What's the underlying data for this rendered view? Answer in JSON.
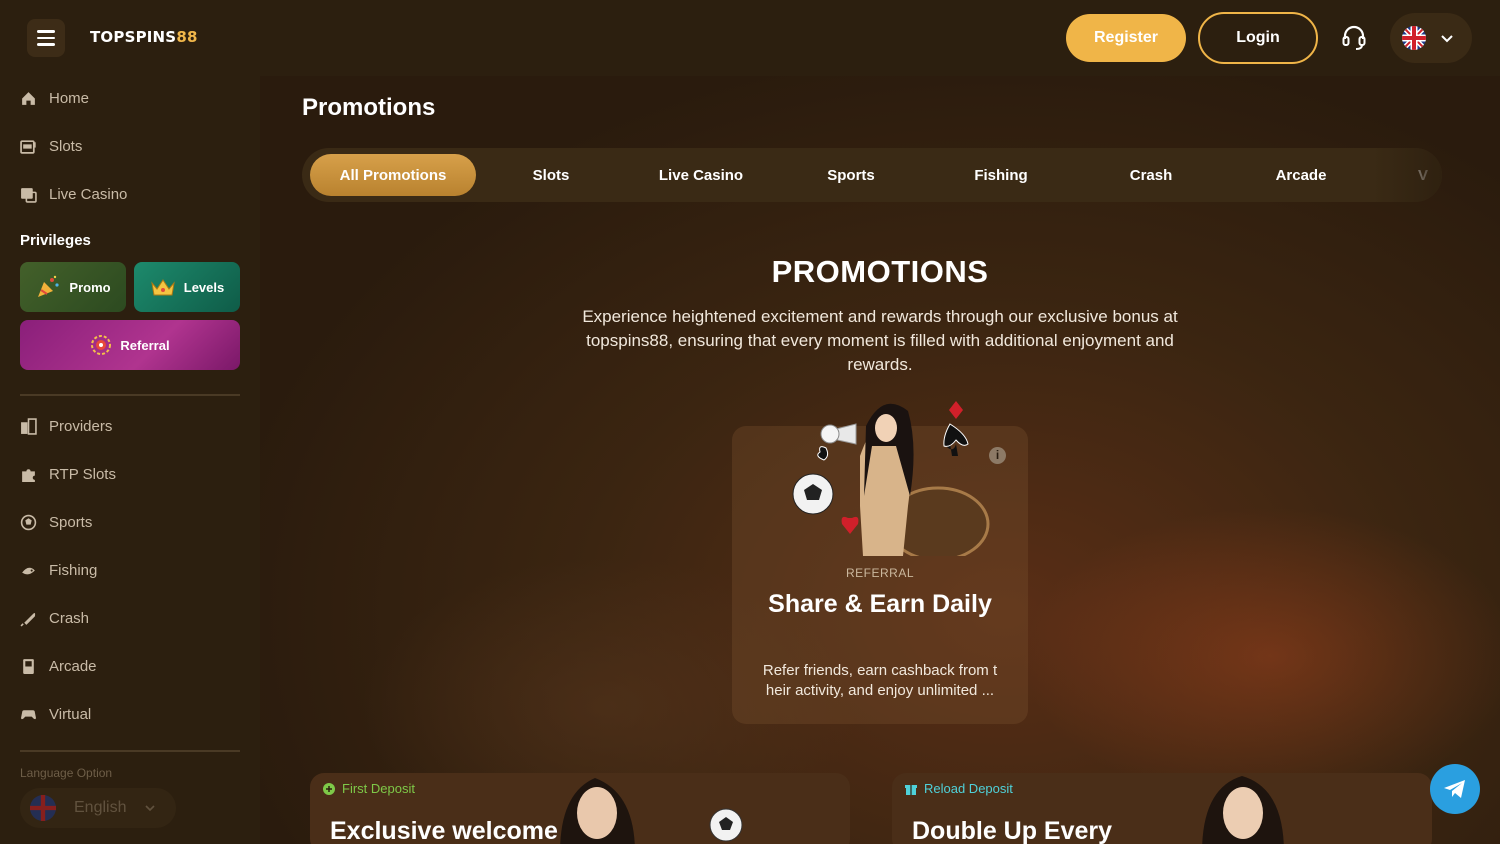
{
  "header": {
    "logo_text": "TOPSPINS",
    "logo_num": "88",
    "register_label": "Register",
    "login_label": "Login"
  },
  "sidebar": {
    "nav_top": [
      {
        "label": "Home",
        "icon": "home-icon"
      },
      {
        "label": "Slots",
        "icon": "slot-machine-icon"
      },
      {
        "label": "Live Casino",
        "icon": "live-casino-icon"
      }
    ],
    "privileges_title": "Privileges",
    "privileges": {
      "promo": "Promo",
      "levels": "Levels",
      "referral": "Referral"
    },
    "nav_games": [
      {
        "label": "Providers",
        "icon": "providers-icon"
      },
      {
        "label": "RTP Slots",
        "icon": "puzzle-icon"
      },
      {
        "label": "Sports",
        "icon": "soccer-ball-icon"
      },
      {
        "label": "Fishing",
        "icon": "fishing-icon"
      },
      {
        "label": "Crash",
        "icon": "rocket-icon"
      },
      {
        "label": "Arcade",
        "icon": "arcade-icon"
      },
      {
        "label": "Virtual",
        "icon": "gamepad-icon"
      }
    ],
    "language_label": "Language Option",
    "language_value": "English"
  },
  "main": {
    "page_title": "Promotions",
    "tabs": [
      "All Promotions",
      "Slots",
      "Live Casino",
      "Sports",
      "Fishing",
      "Crash",
      "Arcade",
      "V"
    ],
    "hero_title": "PROMOTIONS",
    "hero_desc": "Experience heightened excitement and rewards through our exclusive bonus at topspins88, ensuring that every moment is filled with additional enjoyment and rewards.",
    "referral_card": {
      "tag": "REFERRAL",
      "title": "Share & Earn Daily",
      "desc": "Refer friends, earn cashback from t heir activity, and enjoy unlimited ..."
    },
    "promo_cards": [
      {
        "tag": "First Deposit",
        "title": "Exclusive welcome",
        "tag_color": "#7ec948"
      },
      {
        "tag": "Reload Deposit",
        "title": "Double Up Every",
        "tag_color": "#4fd1d9"
      }
    ]
  },
  "colors": {
    "accent": "#f0b548",
    "sidebar_bg": "#2c1f0f",
    "telegram": "#2a9fe0"
  }
}
